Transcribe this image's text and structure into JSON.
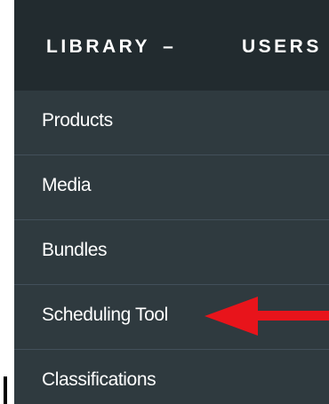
{
  "nav": {
    "library_label": "LIBRARY",
    "library_chevron": "–",
    "users_label": "USERS"
  },
  "menu": {
    "items": [
      {
        "label": "Products"
      },
      {
        "label": "Media"
      },
      {
        "label": "Bundles"
      },
      {
        "label": "Scheduling Tool"
      },
      {
        "label": "Classifications"
      }
    ]
  },
  "colors": {
    "topbar_bg": "#222b2f",
    "menu_bg": "#2f3a3f",
    "divider": "#42505a",
    "text": "#ffffff",
    "annotation_arrow": "#e8141b"
  },
  "icons": {
    "library_toggle": "dash-icon",
    "annotation": "red-arrow-icon"
  }
}
